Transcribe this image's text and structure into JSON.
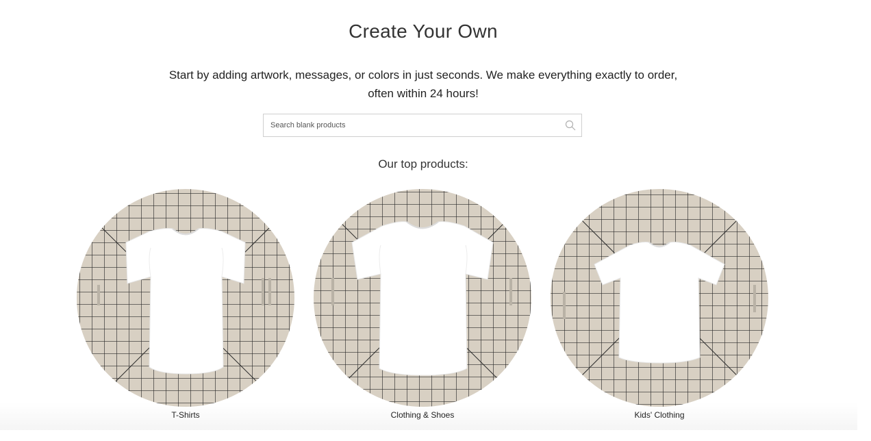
{
  "header": {
    "title": "Create Your Own",
    "subtitle_line1": "Start by adding artwork, messages, or colors in just seconds. We make everything exactly to order,",
    "subtitle_line2": "often within 24 hours!"
  },
  "search": {
    "placeholder": "Search blank products",
    "value": "",
    "icon": "search-icon"
  },
  "top_products": {
    "label": "Our top products:",
    "items": [
      {
        "label": "T-Shirts",
        "image": "white-tshirt-on-cutting-mat"
      },
      {
        "label": "Clothing & Shoes",
        "image": "white-tshirt-on-cutting-mat"
      },
      {
        "label": "Kids' Clothing",
        "image": "kids-white-tshirt-on-cutting-mat"
      }
    ]
  },
  "colors": {
    "mat": "#d8d0c3",
    "grid": "#2a2a2a",
    "shirt": "#ffffff"
  }
}
